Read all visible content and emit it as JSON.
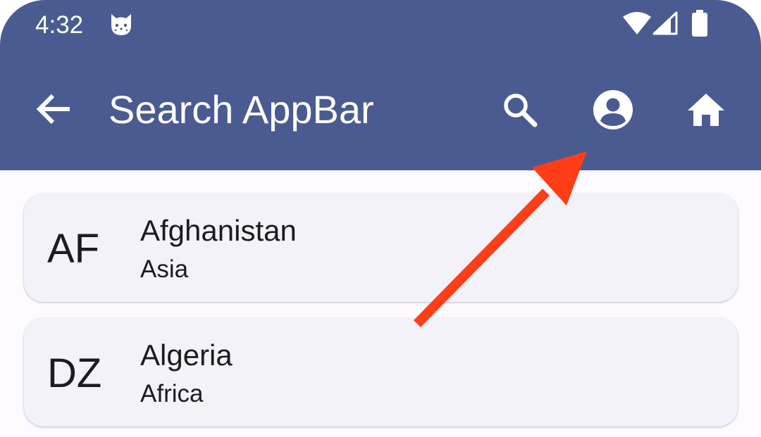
{
  "status_bar": {
    "time": "4:32",
    "notification_icon": "cat-face-icon",
    "icons": [
      "wifi-icon",
      "cell-signal-icon",
      "battery-icon"
    ]
  },
  "app_bar": {
    "title": "Search AppBar",
    "navigation_icon": "arrow-back-icon",
    "actions": [
      "search-icon",
      "account-circle-icon",
      "home-icon"
    ],
    "background_color": "#4a5b91"
  },
  "countries": [
    {
      "code": "AF",
      "name": "Afghanistan",
      "continent": "Asia"
    },
    {
      "code": "DZ",
      "name": "Algeria",
      "continent": "Africa"
    }
  ],
  "annotation": {
    "type": "arrow",
    "color": "#ff3d17",
    "points_to": "account-circle-icon"
  },
  "colors": {
    "surface": "#fdfbff",
    "card": "#f3f2f8",
    "on_surface": "#1b1b21",
    "on_primary": "#ffffff"
  }
}
